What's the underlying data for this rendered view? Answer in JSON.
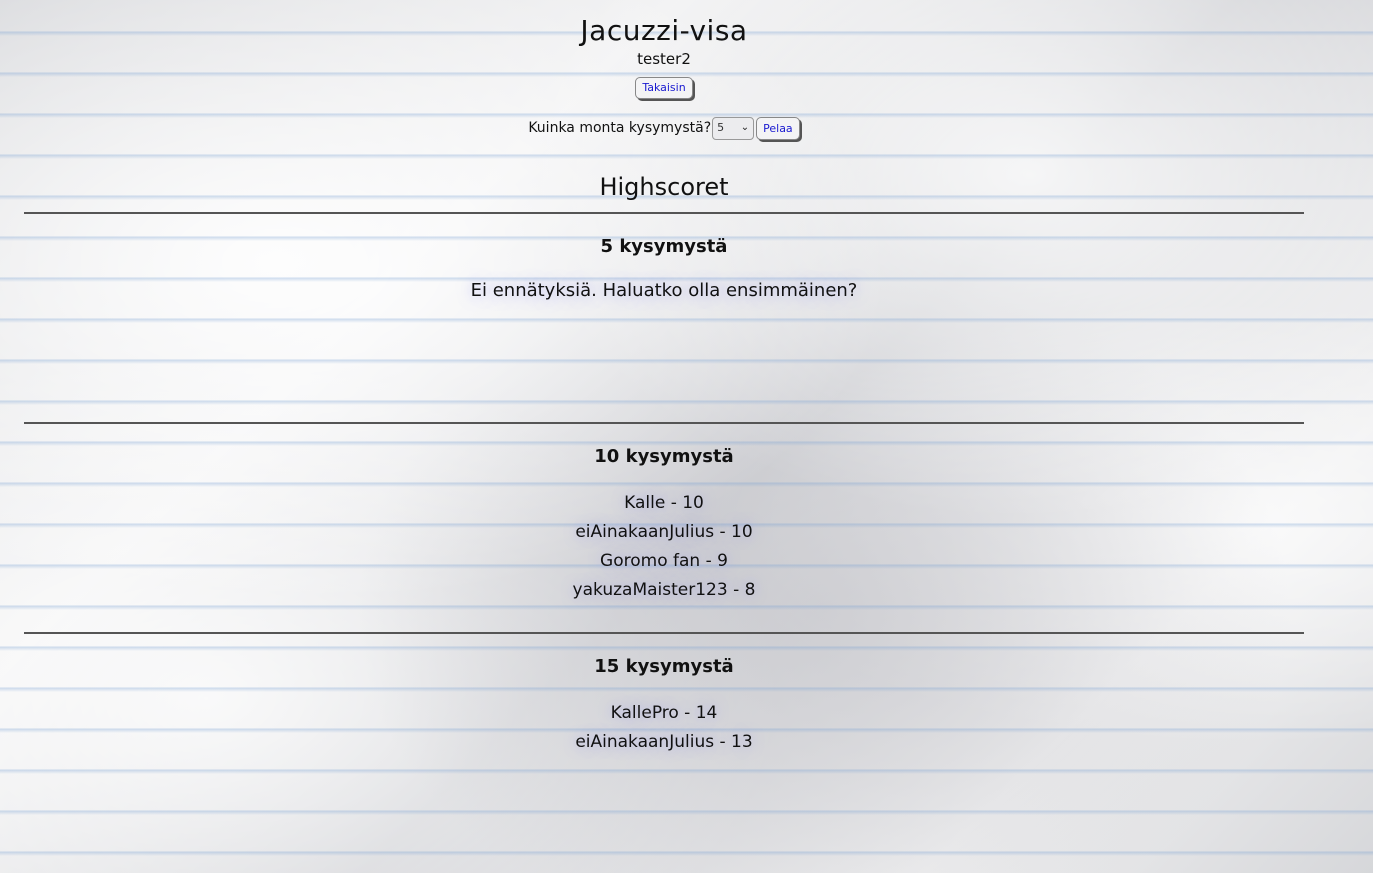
{
  "header": {
    "title": "Jacuzzi-visa",
    "username": "tester2",
    "back_label": "Takaisin"
  },
  "play": {
    "prompt": "Kuinka monta kysymystä?",
    "selected_count": "5",
    "play_label": "Pelaa"
  },
  "highscores": {
    "heading": "Highscoret",
    "sections": [
      {
        "title": "5 kysymystä",
        "empty_message": "Ei ennätyksiä. Haluatko olla ensimmäinen?",
        "entries": []
      },
      {
        "title": "10 kysymystä",
        "entries": [
          "Kalle - 10",
          "eiAinakaanJulius - 10",
          "Goromo fan - 9",
          "yakuzaMaister123 - 8"
        ]
      },
      {
        "title": "15 kysymystä",
        "entries": [
          "KallePro - 14",
          "eiAinakaanJulius - 13"
        ]
      }
    ]
  }
}
